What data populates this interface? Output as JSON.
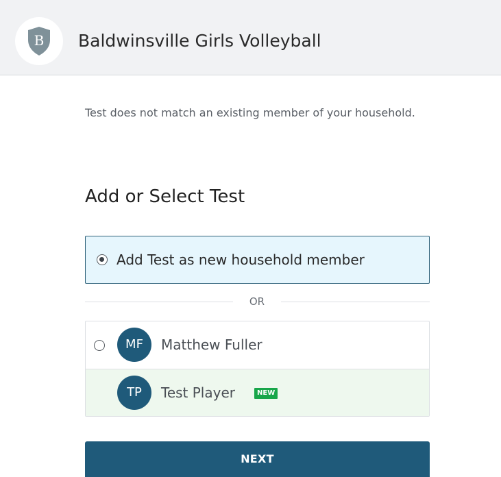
{
  "header": {
    "logo_letter": "B",
    "org_name": "Baldwinsville Girls Volleyball"
  },
  "notice": {
    "text": "Test does not match an existing member of your household."
  },
  "section": {
    "heading": "Add or Select Test"
  },
  "add_option": {
    "label": "Add Test as new household member",
    "selected": true
  },
  "divider": {
    "text": "OR"
  },
  "members": [
    {
      "initials": "MF",
      "name": "Matthew Fuller",
      "selected": false
    },
    {
      "initials": "TP",
      "name": "Test Player",
      "badge": "NEW"
    }
  ],
  "actions": {
    "next_label": "NEXT"
  },
  "colors": {
    "primary": "#1f5a7a",
    "selected_bg": "#e6f6fd",
    "new_badge": "#18a64a",
    "new_row_bg": "#eef8ee",
    "header_bg": "#f1f2f4"
  }
}
